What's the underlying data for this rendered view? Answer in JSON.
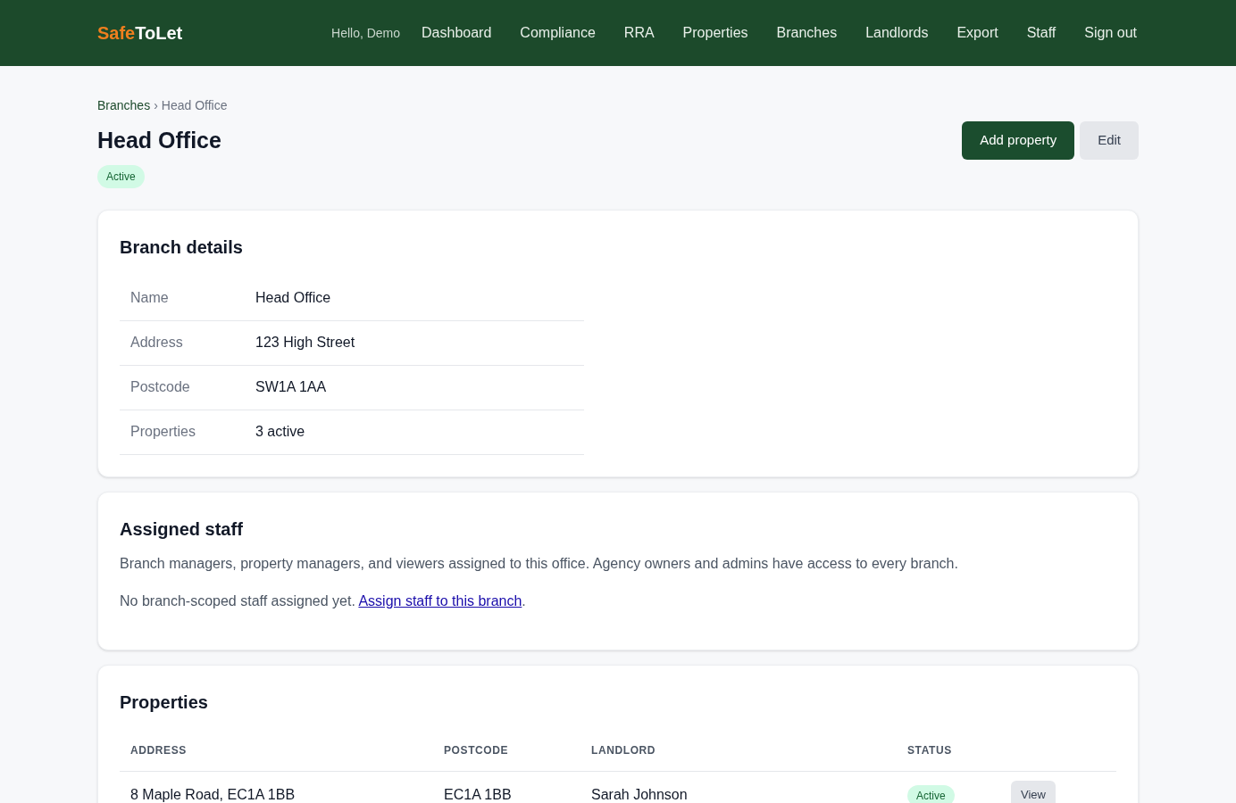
{
  "header": {
    "logo": [
      {
        "text": "Safe",
        "color": "#f07f1e"
      },
      {
        "text": "ToLet",
        "color": "#ffffff"
      }
    ],
    "greeting": "Hello, Demo",
    "nav": [
      "Dashboard",
      "Compliance",
      "RRA",
      "Properties",
      "Branches",
      "Landlords",
      "Export",
      "Staff",
      "Sign out"
    ]
  },
  "breadcrumb": {
    "parent": "Branches",
    "separator": "›",
    "current": "Head Office"
  },
  "title": "Head Office",
  "status_badge": "Active",
  "actions": [
    {
      "label": "Add property",
      "kind": "primary"
    },
    {
      "label": "Edit",
      "kind": "secondary"
    }
  ],
  "branch_details": {
    "title": "Branch details",
    "rows": [
      {
        "label": "Name",
        "value": "Head Office"
      },
      {
        "label": "Address",
        "value": "123 High Street"
      },
      {
        "label": "Postcode",
        "value": "SW1A 1AA"
      },
      {
        "label": "Properties",
        "value": "3 active"
      }
    ]
  },
  "assigned_staff": {
    "title": "Assigned staff",
    "description": "Branch managers, property managers, and viewers assigned to this office. Agency owners and admins have access to every branch.",
    "empty_text": "No branch-scoped staff assigned yet. ",
    "link": "Assign staff to this branch",
    "after_link": "."
  },
  "properties": {
    "title": "Properties",
    "columns": [
      "ADDRESS",
      "POSTCODE",
      "LANDLORD",
      "STATUS"
    ],
    "rows": [
      {
        "address": "8 Maple Road, EC1A 1BB",
        "postcode": "EC1A 1BB",
        "landlord": "Sarah Johnson",
        "status": "Active",
        "action": "View"
      }
    ]
  }
}
